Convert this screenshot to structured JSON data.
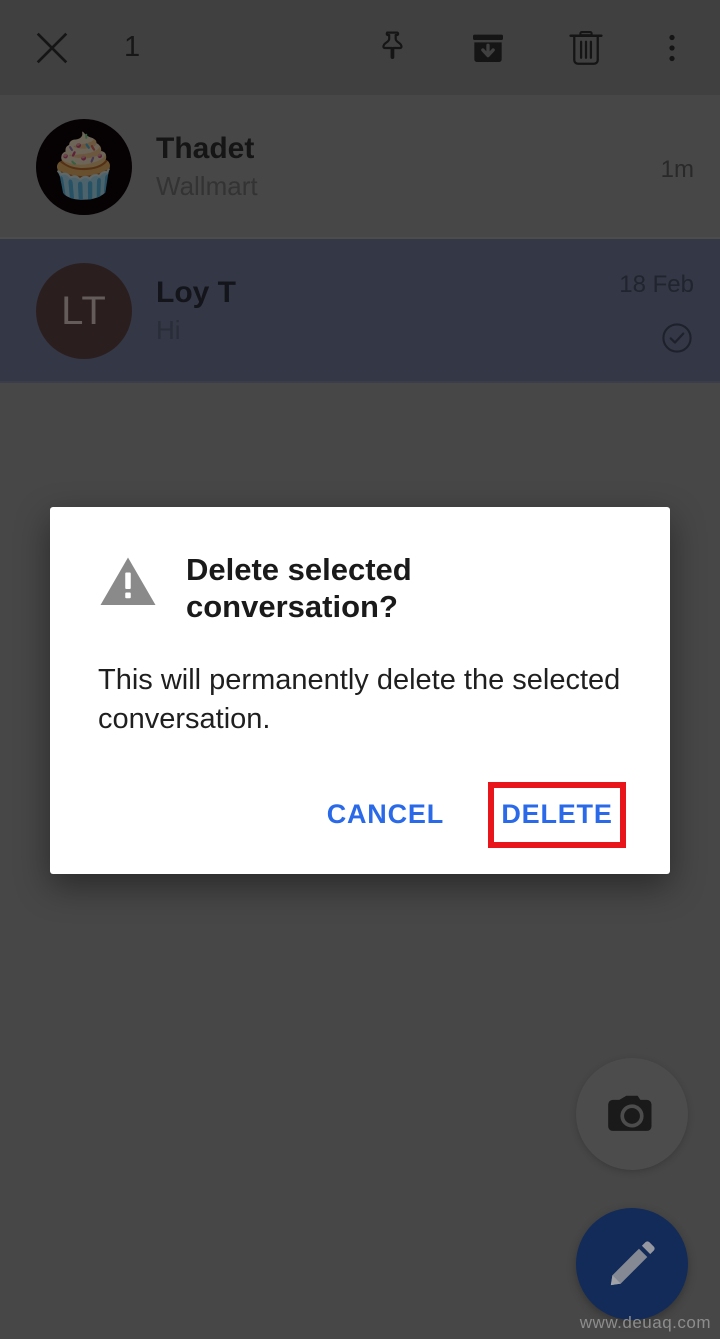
{
  "action_bar": {
    "close_icon": "close-icon",
    "selection_count": "1",
    "pin_icon": "pin-icon",
    "archive_icon": "archive-icon",
    "delete_icon": "trash-icon",
    "overflow_icon": "more-vertical-icon"
  },
  "conversations": [
    {
      "name": "Thadet",
      "snippet": "Wallmart",
      "time": "1m",
      "avatar_type": "photo",
      "avatar_emoji": "🧁",
      "avatar_initials": "",
      "selected": false,
      "has_check": false
    },
    {
      "name": "Loy T",
      "snippet": "Hi",
      "time": "18 Feb",
      "avatar_type": "initials",
      "avatar_emoji": "",
      "avatar_initials": "LT",
      "selected": true,
      "has_check": true
    }
  ],
  "fabs": {
    "camera_icon": "camera-icon",
    "compose_icon": "pencil-icon"
  },
  "dialog": {
    "warning_icon": "warning-triangle-icon",
    "title": "Delete selected conversation?",
    "message": "This will permanently delete the selected conversation.",
    "cancel_label": "CANCEL",
    "delete_label": "DELETE",
    "highlight_color": "#e8161a",
    "action_color": "#2a6ae8"
  },
  "watermark": "www.deuaq.com",
  "colors": {
    "action_bar_bg": "#5c5c5c",
    "list_bg": "#666666",
    "selected_row_bg": "#4b5064",
    "compose_fab_bg": "#1b3e80",
    "camera_fab_bg": "#6d6d6d",
    "dialog_bg": "#ffffff"
  }
}
